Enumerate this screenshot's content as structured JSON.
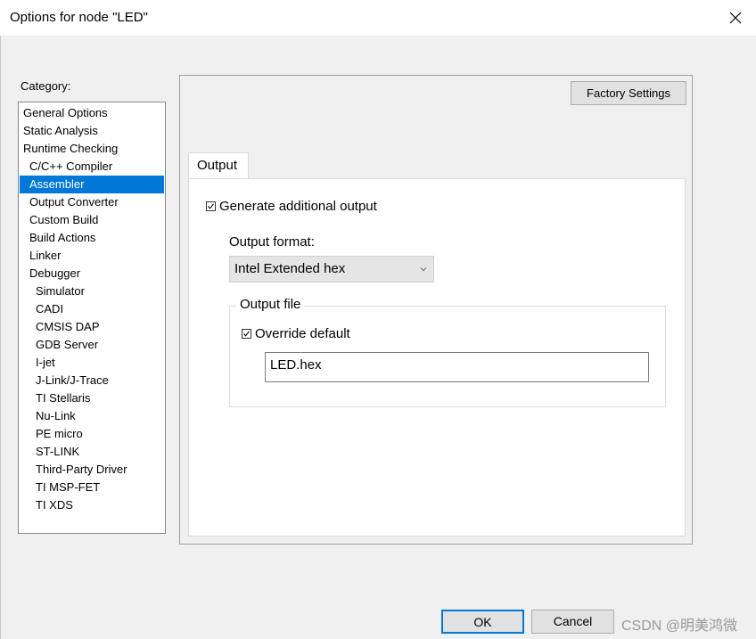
{
  "window": {
    "title": "Options for node \"LED\"",
    "close_icon": "close-icon"
  },
  "category": {
    "label": "Category:",
    "selected_index": 4,
    "items": [
      {
        "label": "General Options",
        "level": 0
      },
      {
        "label": "Static Analysis",
        "level": 0
      },
      {
        "label": "Runtime Checking",
        "level": 0
      },
      {
        "label": "C/C++ Compiler",
        "level": 1
      },
      {
        "label": "Assembler",
        "level": 1
      },
      {
        "label": "Output Converter",
        "level": 1
      },
      {
        "label": "Custom Build",
        "level": 1
      },
      {
        "label": "Build Actions",
        "level": 1
      },
      {
        "label": "Linker",
        "level": 1
      },
      {
        "label": "Debugger",
        "level": 1
      },
      {
        "label": "Simulator",
        "level": 2
      },
      {
        "label": "CADI",
        "level": 2
      },
      {
        "label": "CMSIS DAP",
        "level": 2
      },
      {
        "label": "GDB Server",
        "level": 2
      },
      {
        "label": "I-jet",
        "level": 2
      },
      {
        "label": "J-Link/J-Trace",
        "level": 2
      },
      {
        "label": "TI Stellaris",
        "level": 2
      },
      {
        "label": "Nu-Link",
        "level": 2
      },
      {
        "label": "PE micro",
        "level": 2
      },
      {
        "label": "ST-LINK",
        "level": 2
      },
      {
        "label": "Third-Party Driver",
        "level": 2
      },
      {
        "label": "TI MSP-FET",
        "level": 2
      },
      {
        "label": "TI XDS",
        "level": 2
      }
    ]
  },
  "panel": {
    "factory_settings_label": "Factory Settings",
    "tab_label": "Output",
    "generate_output": {
      "label": "Generate additional output",
      "checked": true
    },
    "output_format": {
      "label": "Output format:",
      "value": "Intel Extended hex"
    },
    "output_file": {
      "group_label": "Output file",
      "override": {
        "label": "Override default",
        "checked": true
      },
      "filename": "LED.hex"
    }
  },
  "buttons": {
    "ok": "OK",
    "cancel": "Cancel"
  },
  "watermark": "CSDN @明美鸿微",
  "colors": {
    "selection": "#0078d7"
  }
}
